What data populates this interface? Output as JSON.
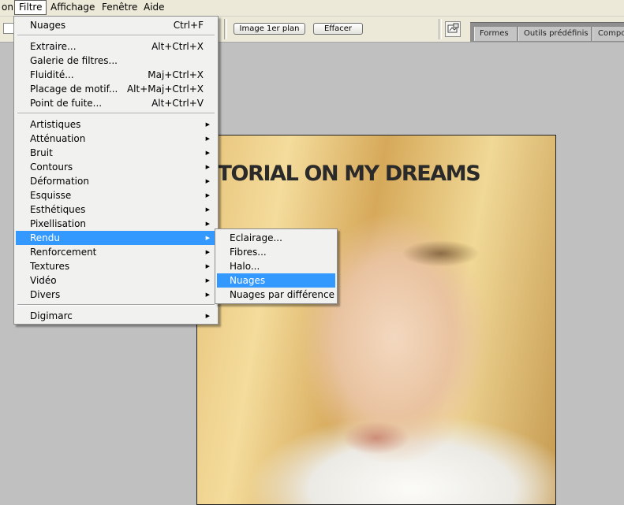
{
  "menubar": {
    "items": [
      "on",
      "Filtre",
      "Affichage",
      "Fenêtre",
      "Aide"
    ]
  },
  "optionsbar": {
    "image_front_label": "Image 1er plan",
    "clear_label": "Effacer",
    "dock_tabs": [
      "Formes",
      "Outils prédéfinis",
      "Compo"
    ]
  },
  "canvas": {
    "title": "TUTORIAL ON MY DREAMS"
  },
  "filtre_menu": {
    "last_filter": {
      "label": "Nuages",
      "shortcut": "Ctrl+F"
    },
    "group2": [
      {
        "label": "Extraire...",
        "shortcut": "Alt+Ctrl+X"
      },
      {
        "label": "Galerie de filtres...",
        "shortcut": ""
      },
      {
        "label": "Fluidité...",
        "shortcut": "Maj+Ctrl+X"
      },
      {
        "label": "Placage de motif...",
        "shortcut": "Alt+Maj+Ctrl+X"
      },
      {
        "label": "Point de fuite...",
        "shortcut": "Alt+Ctrl+V"
      }
    ],
    "categories": [
      "Artistiques",
      "Atténuation",
      "Bruit",
      "Contours",
      "Déformation",
      "Esquisse",
      "Esthétiques",
      "Pixellisation",
      "Rendu",
      "Renforcement",
      "Textures",
      "Vidéo",
      "Divers"
    ],
    "highlighted_category": "Rendu",
    "digimarc": "Digimarc"
  },
  "rendu_submenu": {
    "items": [
      "Eclairage...",
      "Fibres...",
      "Halo...",
      "Nuages",
      "Nuages par différence"
    ],
    "highlighted": "Nuages"
  },
  "colors": {
    "highlight": "#3399ff",
    "menu_bg": "#f1f1ef",
    "workspace": "#c0c0c0"
  }
}
